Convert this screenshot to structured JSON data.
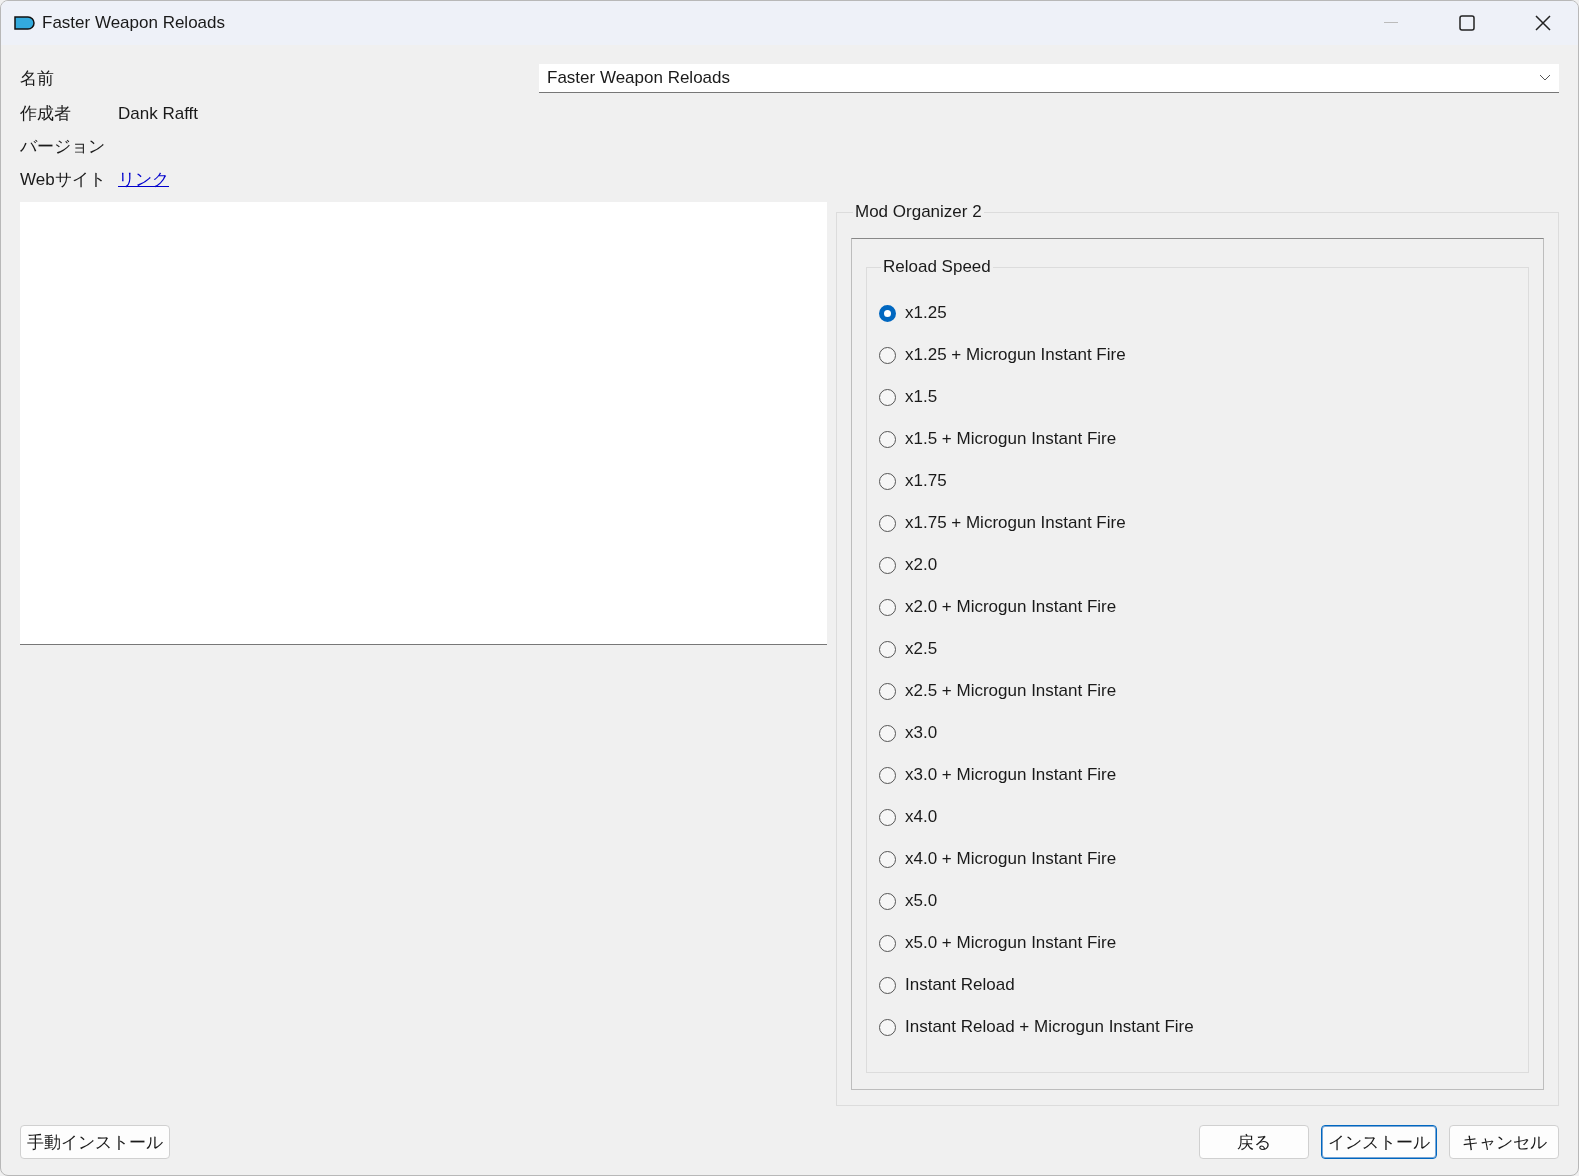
{
  "window": {
    "title": "Faster Weapon Reloads"
  },
  "info": {
    "name_label": "名前",
    "name_value": "Faster Weapon Reloads",
    "author_label": "作成者",
    "author": "Dank Rafft",
    "version_label": "バージョン",
    "website_label": "Webサイト",
    "website_link": "リンク"
  },
  "group": {
    "title": "Mod Organizer 2",
    "subgroup": {
      "title": "Reload Speed",
      "options": [
        {
          "label": "x1.25",
          "selected": true
        },
        {
          "label": "x1.25 + Microgun Instant Fire",
          "selected": false
        },
        {
          "label": "x1.5",
          "selected": false
        },
        {
          "label": "x1.5 + Microgun Instant Fire",
          "selected": false
        },
        {
          "label": "x1.75",
          "selected": false
        },
        {
          "label": "x1.75 + Microgun Instant Fire",
          "selected": false
        },
        {
          "label": "x2.0",
          "selected": false
        },
        {
          "label": "x2.0 + Microgun Instant Fire",
          "selected": false
        },
        {
          "label": "x2.5",
          "selected": false
        },
        {
          "label": "x2.5 + Microgun Instant Fire",
          "selected": false
        },
        {
          "label": "x3.0",
          "selected": false
        },
        {
          "label": "x3.0 + Microgun Instant Fire",
          "selected": false
        },
        {
          "label": "x4.0",
          "selected": false
        },
        {
          "label": "x4.0 + Microgun Instant Fire",
          "selected": false
        },
        {
          "label": "x5.0",
          "selected": false
        },
        {
          "label": "x5.0 + Microgun Instant Fire",
          "selected": false
        },
        {
          "label": "Instant Reload",
          "selected": false
        },
        {
          "label": "Instant Reload + Microgun Instant Fire",
          "selected": false
        }
      ]
    }
  },
  "buttons": {
    "manual": "手動インストール",
    "actions": [
      {
        "label": "戻る",
        "default": false
      },
      {
        "label": "インストール",
        "default": true
      },
      {
        "label": "キャンセル",
        "default": false
      }
    ]
  }
}
